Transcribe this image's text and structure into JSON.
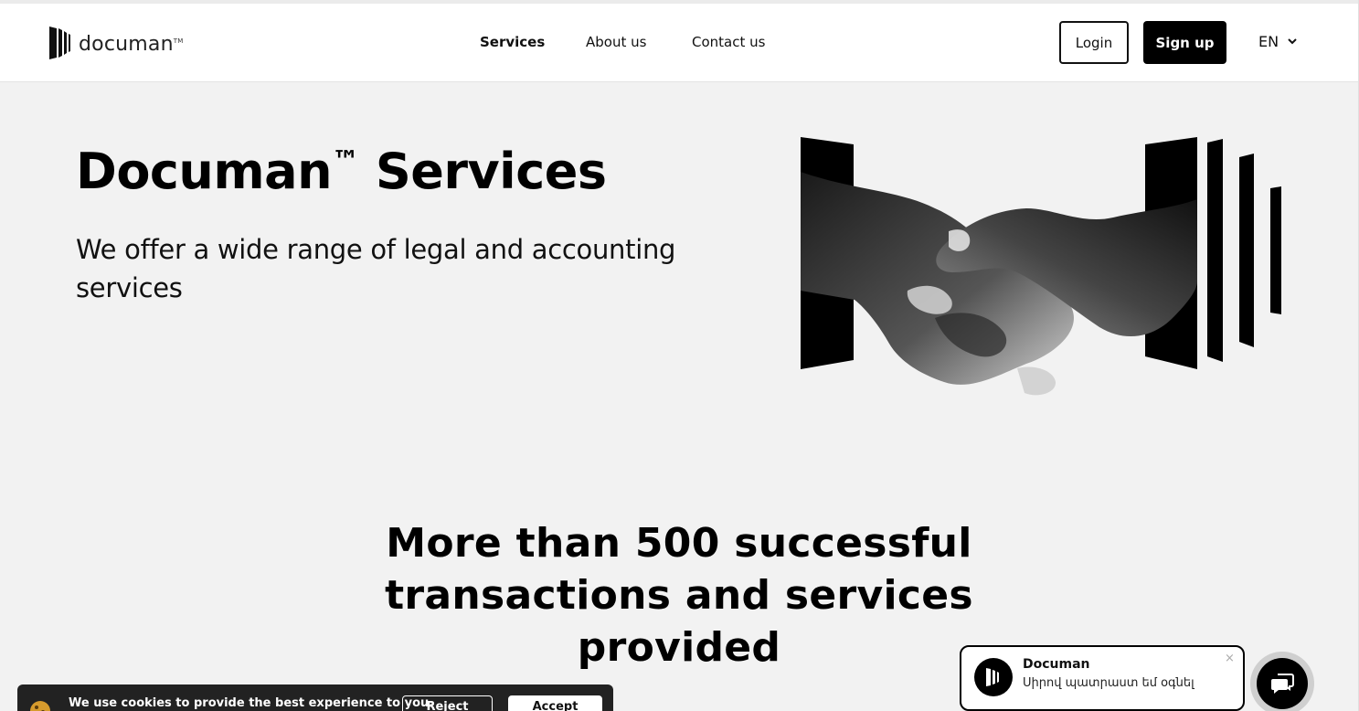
{
  "header": {
    "logo_text": "documan",
    "logo_tm": "TM",
    "nav": [
      {
        "label": "Services",
        "active": true
      },
      {
        "label": "About us",
        "active": false
      },
      {
        "label": "Contact us",
        "active": false
      }
    ],
    "login_label": "Login",
    "signup_label": "Sign up",
    "language": "EN",
    "language_icon": "chevron-down-icon"
  },
  "hero": {
    "title_brand": "Documan",
    "title_tm": "™",
    "title_rest": " Services",
    "subtitle": "We offer a wide range of legal and accounting services",
    "image": "handshake-illustration"
  },
  "stats": {
    "title": "More than 500 successful transactions and services provided"
  },
  "cookie_banner": {
    "text": "We use cookies to provide the best experience to you.",
    "reject_label": "Reject",
    "accept_label": "Accept",
    "icon": "cookie-icon"
  },
  "chat": {
    "name": "Documan",
    "message": "Սիրով պատրաստ եմ օգնել",
    "close_glyph": "×",
    "launcher_icon": "chat-icon"
  },
  "colors": {
    "background": "#f2f2f2",
    "header": "#ffffff",
    "primary": "#000000",
    "cookie_bg": "#222222"
  }
}
